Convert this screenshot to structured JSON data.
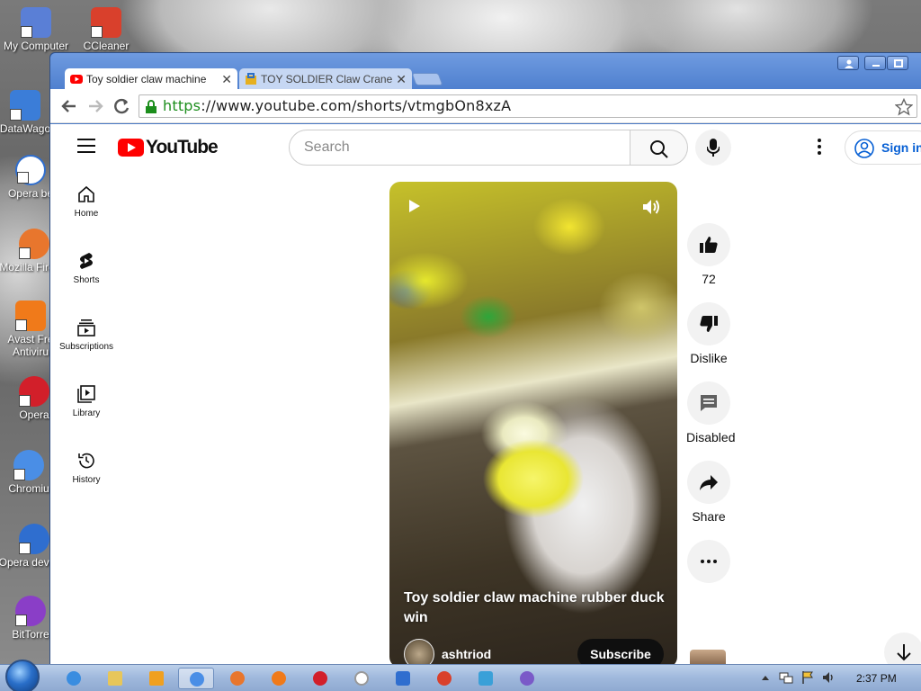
{
  "desktop": {
    "icons": [
      {
        "label": "My Computer",
        "color": "#5a7fd6"
      },
      {
        "label": "CCleaner",
        "color": "#d9402c"
      },
      {
        "label": "DataWago",
        "color": "#3b7dd8"
      },
      {
        "label": "Opera be",
        "color": "#ffffff"
      },
      {
        "label": "Mozilla Firefox",
        "color": "#e8762d"
      },
      {
        "label": "Avast Fre Antiviru",
        "color": "#f07a1a"
      },
      {
        "label": "Opera",
        "color": "#d21f2a"
      },
      {
        "label": "Chromiu",
        "color": "#4a8ee6"
      },
      {
        "label": "Opera develop",
        "color": "#2f6ecf"
      },
      {
        "label": "BitTorre",
        "color": "#8a3ec7"
      }
    ]
  },
  "browser": {
    "tabs": [
      {
        "title": "Toy soldier claw machine",
        "active": true
      },
      {
        "title": "TOY SOLDIER Claw Crane",
        "active": false
      }
    ],
    "url_scheme": "https",
    "url_rest": "://www.youtube.com/shorts/vtmgbOn8xzA"
  },
  "youtube": {
    "logo_text": "YouTube",
    "search_placeholder": "Search",
    "signin_label": "Sign in",
    "nav": [
      {
        "label": "Home",
        "icon": "home-icon"
      },
      {
        "label": "Shorts",
        "icon": "shorts-icon"
      },
      {
        "label": "Subscriptions",
        "icon": "subscriptions-icon"
      },
      {
        "label": "Library",
        "icon": "library-icon"
      },
      {
        "label": "History",
        "icon": "history-icon"
      }
    ],
    "short": {
      "title": "Toy soldier claw machine rubber duck win",
      "channel": "ashtriod",
      "subscribe_label": "Subscribe"
    },
    "actions": {
      "like_count": "72",
      "dislike_label": "Dislike",
      "comments_label": "Disabled",
      "share_label": "Share"
    }
  },
  "taskbar": {
    "clock": "2:37 PM"
  }
}
